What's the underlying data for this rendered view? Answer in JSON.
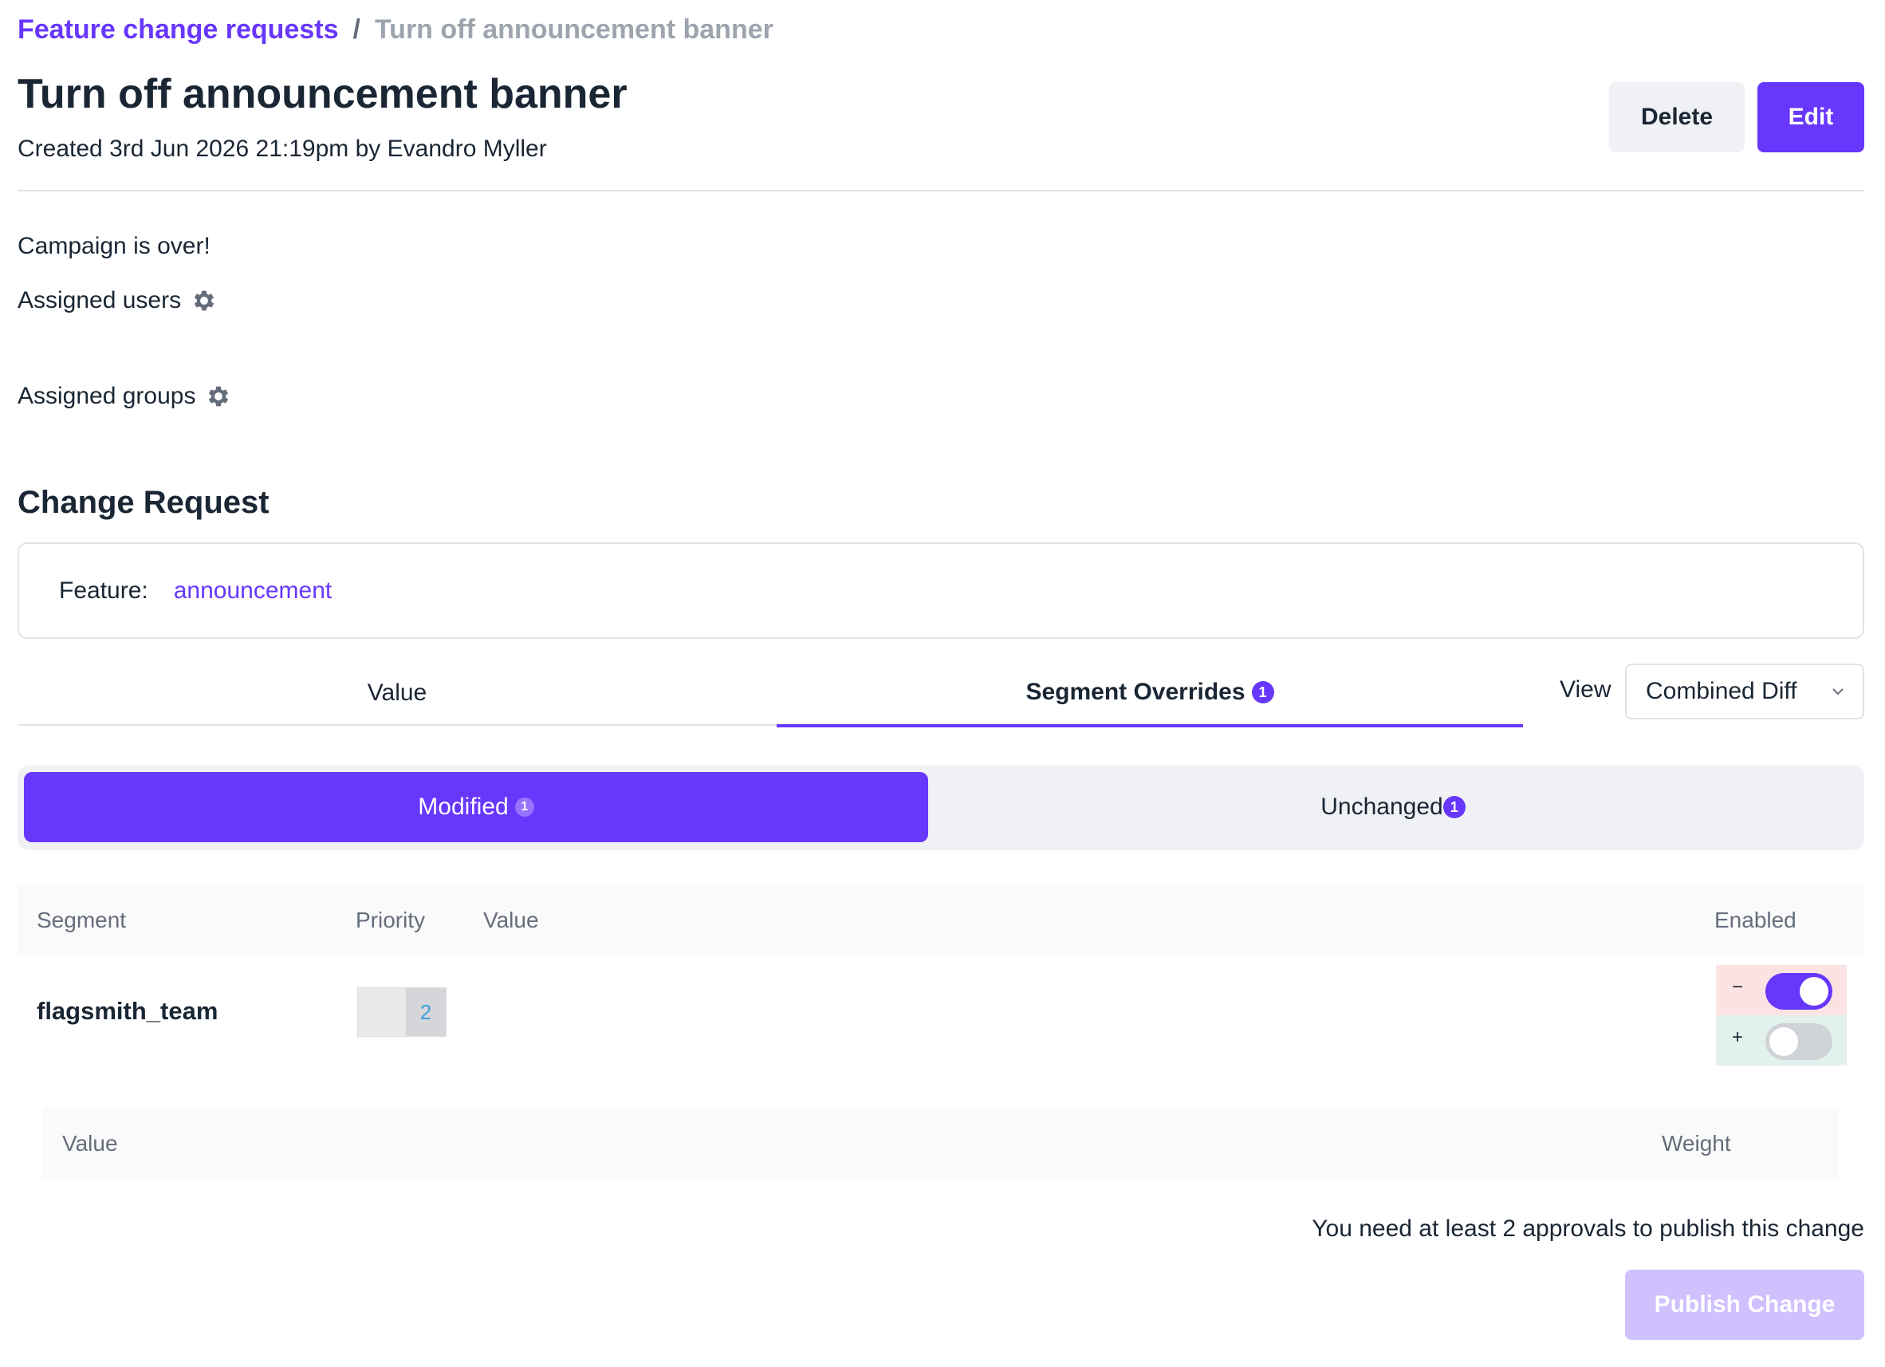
{
  "breadcrumb": {
    "parent": "Feature change requests",
    "separator": "/",
    "current": "Turn off announcement banner"
  },
  "header": {
    "title": "Turn off announcement banner",
    "created": "Created 3rd Jun 2026 21:19pm by Evandro Myller",
    "delete_label": "Delete",
    "edit_label": "Edit"
  },
  "details": {
    "description": "Campaign is over!",
    "assigned_users_label": "Assigned users",
    "assigned_groups_label": "Assigned groups",
    "gear_icon": "gear-icon"
  },
  "change_request": {
    "section_title": "Change Request",
    "feature_label": "Feature:",
    "feature_name": "announcement"
  },
  "tabs": {
    "value_label": "Value",
    "segment_overrides_label": "Segment Overrides",
    "segment_overrides_count": "1",
    "view_label": "View",
    "view_selected": "Combined Diff"
  },
  "segment_filter": {
    "modified_label": "Modified",
    "modified_count": "1",
    "unchanged_label": "Unchanged",
    "unchanged_count": "1"
  },
  "table": {
    "headers": {
      "segment": "Segment",
      "priority": "Priority",
      "value": "Value",
      "enabled": "Enabled"
    },
    "row": {
      "segment": "flagsmith_team",
      "priority": "2",
      "enabled_before": true,
      "enabled_after": false,
      "minus_sign": "−",
      "plus_sign": "+"
    }
  },
  "variations": {
    "value_header": "Value",
    "weight_header": "Weight"
  },
  "footer": {
    "approval_note": "You need at least 2 approvals to publish this change",
    "publish_label": "Publish Change"
  },
  "colors": {
    "accent": "#6837fc",
    "accent_disabled": "#cfc0fe",
    "diff_removed": "#fbe3e3",
    "diff_added": "#e3f1ec"
  }
}
